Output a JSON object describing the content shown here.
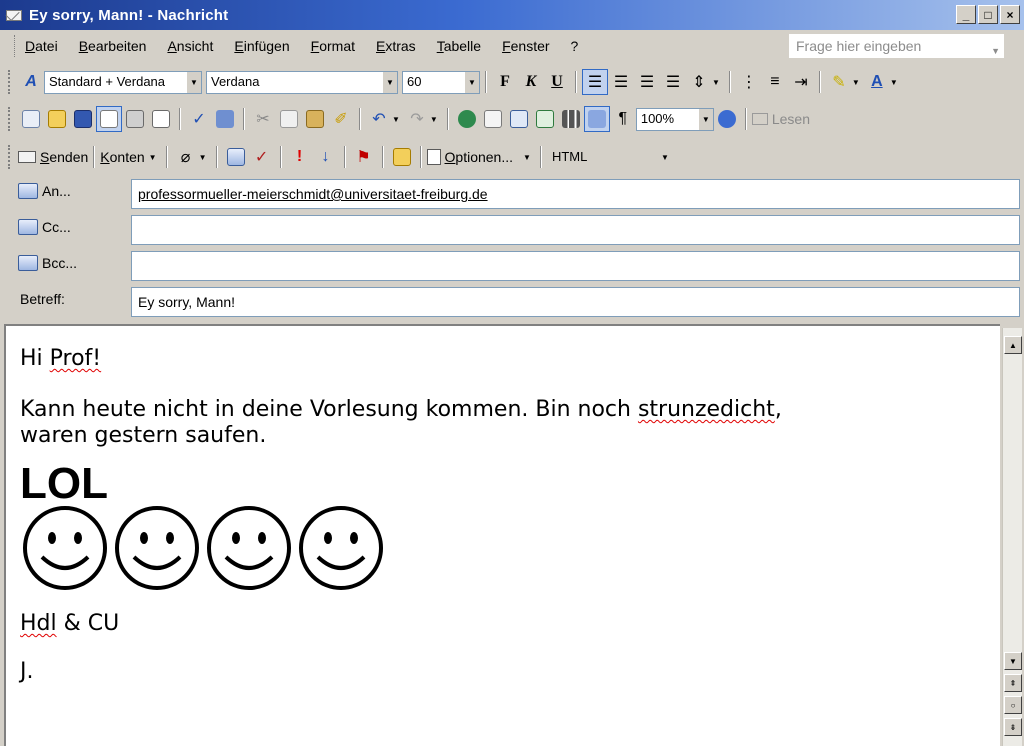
{
  "window": {
    "title": "Ey sorry, Mann! - Nachricht",
    "controls": [
      "_",
      "□",
      "×"
    ]
  },
  "menu": {
    "items": [
      "Datei",
      "Bearbeiten",
      "Ansicht",
      "Einfügen",
      "Format",
      "Extras",
      "Tabelle",
      "Fenster",
      "?"
    ],
    "help_placeholder": "Frage hier eingeben"
  },
  "format_toolbar": {
    "style": "Standard + Verdana",
    "font": "Verdana",
    "size": "60",
    "bold": "F",
    "italic": "K",
    "underline": "U"
  },
  "standard_toolbar": {
    "zoom": "100%",
    "read_label": "Lesen"
  },
  "mail_toolbar": {
    "send_label": "Senden",
    "accounts_label": "Konten",
    "options_label": "Optionen...",
    "format_value": "HTML"
  },
  "fields": {
    "to_label": "An...",
    "to_value": "professormueller-meierschmidt@universitaet-freiburg.de",
    "cc_label": "Cc...",
    "cc_value": "",
    "bcc_label": "Bcc...",
    "bcc_value": "",
    "subject_label": "Betreff:",
    "subject_value": "Ey sorry, Mann!"
  },
  "message": {
    "greeting_hi": "Hi",
    "greeting_prof": "Prof!",
    "line1_a": "Kann heute nicht in deine Vorlesung kommen. Bin noch",
    "line1_b": "strunzedicht",
    "line1_c": ",",
    "line2": "waren gestern saufen.",
    "lol": "LOL",
    "smiley_count": 4,
    "signoff_a": "Hdl",
    "signoff_b": " & CU",
    "signature": "J."
  },
  "colors": {
    "titlebar_start": "#1c3a8e",
    "titlebar_end": "#a6c1ec",
    "spellcheck": "#e00000",
    "chrome": "#d4d0c8"
  }
}
